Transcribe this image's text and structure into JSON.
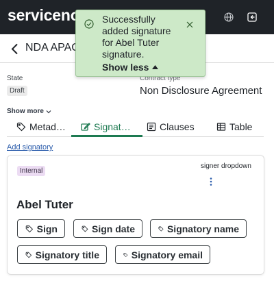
{
  "header": {
    "logo_text": "servicenow",
    "icons": [
      "globe-icon",
      "exit-icon"
    ]
  },
  "record": {
    "title": "NDA APAC"
  },
  "fields": {
    "state_label": "State",
    "state_value": "Draft",
    "contract_type_label": "Contract type",
    "contract_type_value": "Non Disclosure Agreement"
  },
  "show_more": "Show more",
  "tabs": [
    {
      "label": "Metad…",
      "icon": "tag-icon"
    },
    {
      "label": "Signat…",
      "icon": "pencil-icon"
    },
    {
      "label": "Clauses",
      "icon": "document-list-icon"
    },
    {
      "label": "Table",
      "icon": "table-icon"
    }
  ],
  "active_tab_index": 1,
  "add_signatory": "Add signatory",
  "card": {
    "badge": "Internal",
    "signer_label": "signer dropdown",
    "signer_name": "Abel Tuter",
    "chips": [
      {
        "label": "Sign"
      },
      {
        "label": "Sign date"
      },
      {
        "label": "Signatory name"
      },
      {
        "label": "Signatory title"
      },
      {
        "label": "Signatory email"
      }
    ]
  },
  "toast": {
    "message": "Successfully added signature for Abel Tuter signature.",
    "toggle_label": "Show less"
  },
  "colors": {
    "header_bg": "#1f2328",
    "accent_green": "#1d7a51",
    "link_blue": "#2b5cab",
    "toast_bg": "#cde9c8",
    "internal_badge_bg": "#ecdcf3"
  }
}
